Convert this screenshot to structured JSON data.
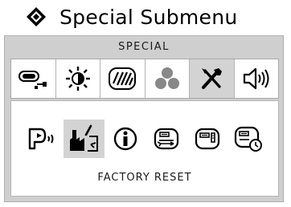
{
  "title": "Special Submenu",
  "panel": {
    "header": "SPECIAL",
    "tabs": [
      {
        "icon": "input-source-icon",
        "selected": false
      },
      {
        "icon": "brightness-icon",
        "selected": false
      },
      {
        "icon": "screen-pattern-icon",
        "selected": false
      },
      {
        "icon": "color-dots-icon",
        "selected": false
      },
      {
        "icon": "tools-icon",
        "selected": true
      },
      {
        "icon": "speaker-icon",
        "selected": false
      }
    ],
    "items": [
      {
        "icon": "language-voice-icon",
        "selected": false
      },
      {
        "icon": "factory-reset-icon",
        "selected": true
      },
      {
        "icon": "info-icon",
        "selected": false
      },
      {
        "icon": "display-swap-icon",
        "selected": false
      },
      {
        "icon": "display-pip-icon",
        "selected": false
      },
      {
        "icon": "display-timer-icon",
        "selected": false
      }
    ],
    "selected_label": "FACTORY RESET"
  }
}
